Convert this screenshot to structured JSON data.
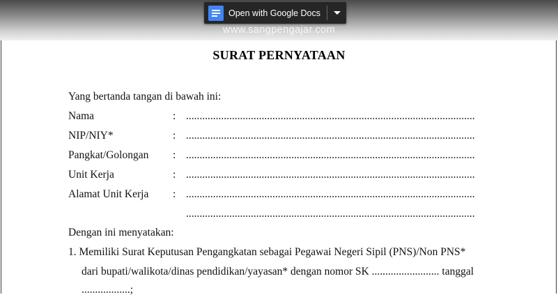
{
  "toolbar": {
    "open_label": "Open with Google Docs",
    "docs_icon": "google-docs-icon",
    "dropdown_icon": "caret-down-icon"
  },
  "watermark": "www.sangpengajar.com",
  "document": {
    "title": "SURAT PERNYATAAN",
    "intro": "Yang bertanda tangan di bawah ini:",
    "colon": ":",
    "dots": "..............................................................................................................",
    "fields": [
      "Nama",
      "NIP/NIY*",
      "Pangkat/Golongan",
      "Unit Kerja",
      "Alamat Unit Kerja"
    ],
    "statement_intro": "Dengan ini menyatakan:",
    "item1_line1": "1. Memiliki Surat Keputusan Pengangkatan sebagai Pegawai Negeri Sipil (PNS)/Non PNS*",
    "item1_line2": "dari bupati/walikota/dinas pendidikan/yayasan* dengan nomor SK ......................... tanggal",
    "item1_line3": "..................;"
  },
  "colors": {
    "docs_blue": "#4285f4",
    "button_bg": "#262626"
  }
}
